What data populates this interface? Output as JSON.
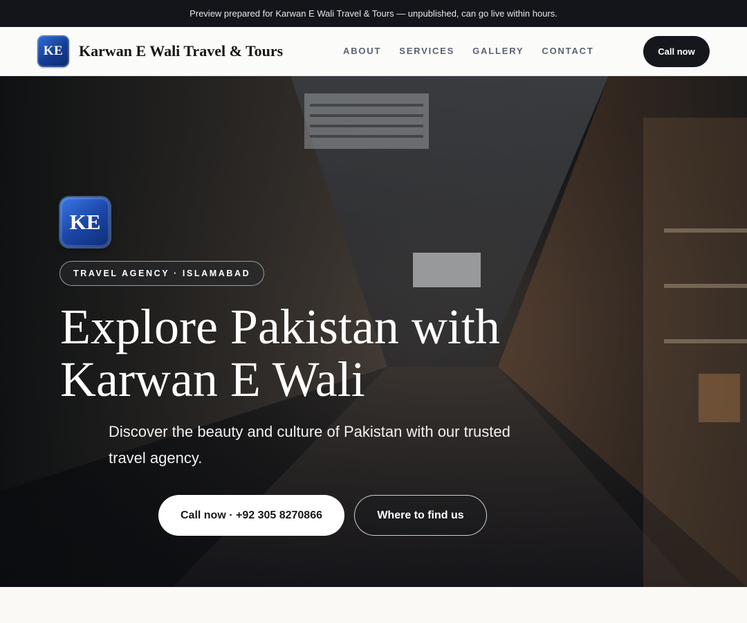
{
  "topbar": {
    "text": "Preview prepared for Karwan E Wali Travel & Tours — unpublished, can go live within hours."
  },
  "nav": {
    "logo_initials": "KE",
    "brand_name": "Karwan E Wali Travel & Tours",
    "links": [
      "ABOUT",
      "SERVICES",
      "GALLERY",
      "CONTACT"
    ],
    "cta_label": "Call now"
  },
  "hero": {
    "logo_initials": "KE",
    "tag": "TRAVEL AGENCY · ISLAMABAD",
    "title_line1": "Explore Pakistan with",
    "title_line2": "Karwan E Wali",
    "subtitle": "Discover the beauty and culture of Pakistan with our trusted travel agency.",
    "primary_button": "Call now · +92 305 8270866",
    "secondary_button": "Where to find us",
    "background_image": "market-alley-photo"
  },
  "colors": {
    "topbar_bg": "#13151a",
    "accent_dark": "#15171c",
    "logo_blue": "#1b47a8",
    "nav_link": "#5b6170"
  }
}
